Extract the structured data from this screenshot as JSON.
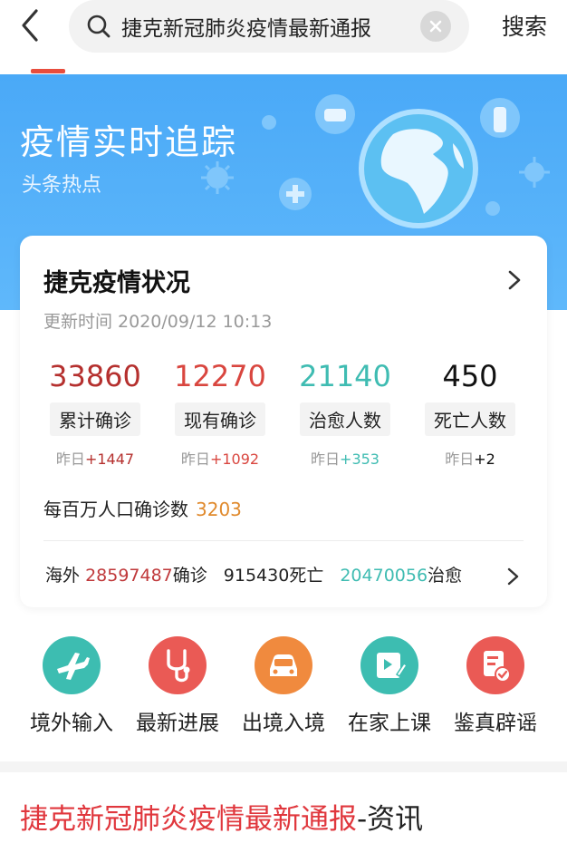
{
  "search": {
    "query": "捷克新冠肺炎疫情最新通报",
    "button_label": "搜索"
  },
  "banner": {
    "title": "疫情实时追踪",
    "subtitle": "头条热点"
  },
  "card": {
    "title": "捷克疫情状况",
    "update_time": "更新时间 2020/09/12 10:13",
    "stats": [
      {
        "value": "33860",
        "label": "累计确诊",
        "delta_prefix": "昨日",
        "delta": "+1447",
        "color": "#b5302e"
      },
      {
        "value": "12270",
        "label": "现有确诊",
        "delta_prefix": "昨日",
        "delta": "+1092",
        "color": "#d9463f"
      },
      {
        "value": "21140",
        "label": "治愈人数",
        "delta_prefix": "昨日",
        "delta": "+353",
        "color": "#3fbcb2"
      },
      {
        "value": "450",
        "label": "死亡人数",
        "delta_prefix": "昨日",
        "delta": "+2",
        "color": "#111111"
      }
    ],
    "per_million_label": "每百万人口确诊数",
    "per_million_value": "3203",
    "overseas": {
      "prefix": "海外",
      "confirmed": "28597487",
      "confirmed_label": "确诊",
      "deaths": "915430",
      "deaths_label": "死亡",
      "recovered": "20470056",
      "recovered_label": "治愈"
    }
  },
  "quick_nav": [
    {
      "label": "境外输入",
      "icon": "airplane-icon",
      "color": "#3dbdb1"
    },
    {
      "label": "最新进展",
      "icon": "stethoscope-icon",
      "color": "#ea5a55"
    },
    {
      "label": "出境入境",
      "icon": "car-icon",
      "color": "#f08a3e"
    },
    {
      "label": "在家上课",
      "icon": "edit-video-icon",
      "color": "#3dbdb1"
    },
    {
      "label": "鉴真辟谣",
      "icon": "verified-doc-icon",
      "color": "#ea5a55"
    }
  ],
  "news": {
    "highlight": "捷克新冠肺炎疫情最新通报",
    "suffix": "-资讯"
  },
  "colors": {
    "accent_red": "#e0373d",
    "banner_blue": "#4aa9f7"
  }
}
